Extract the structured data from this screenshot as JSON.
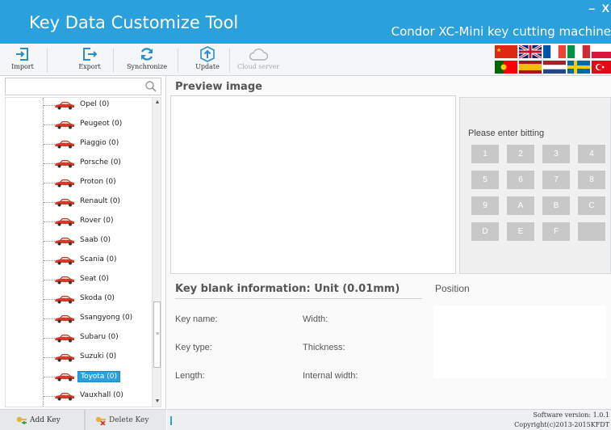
{
  "window": {
    "title": "Key Data Customize Tool",
    "subtitle": "Condor XC-Mini key cutting machine",
    "minimize_glyph": "–",
    "close_glyph": "X"
  },
  "toolbar": {
    "import_label": "Import",
    "export_label": "Export",
    "sync_label": "Synchronize",
    "update_label": "Update",
    "cloud_label": "Cloud server"
  },
  "languages": [
    "Chinese",
    "British",
    "French",
    "Italian",
    "Polish",
    "Portuguese",
    "Spanish",
    "Dutch",
    "Swedish",
    "Turkish"
  ],
  "tree": {
    "items": [
      {
        "label": "Opel (0)"
      },
      {
        "label": "Peugeot (0)"
      },
      {
        "label": "Piaggio (0)"
      },
      {
        "label": "Porsche (0)"
      },
      {
        "label": "Proton (0)"
      },
      {
        "label": "Renault (0)"
      },
      {
        "label": "Rover (0)"
      },
      {
        "label": "Saab (0)"
      },
      {
        "label": "Scania (0)"
      },
      {
        "label": "Seat (0)"
      },
      {
        "label": "Skoda (0)"
      },
      {
        "label": "Ssangyong (0)"
      },
      {
        "label": "Subaru (0)"
      },
      {
        "label": "Suzuki (0)"
      },
      {
        "label": "Toyota (0)"
      },
      {
        "label": "Vauxhall (0)"
      }
    ],
    "selected": "Toyota (0)"
  },
  "left_buttons": {
    "add": "Add Key",
    "delete": "Delete Key"
  },
  "preview": {
    "title": "Preview image"
  },
  "bitting": {
    "label": "Please enter bitting",
    "keys": [
      "1",
      "2",
      "3",
      "4",
      "5",
      "6",
      "7",
      "8",
      "9",
      "A",
      "B",
      "C",
      "D",
      "E",
      "F",
      ""
    ]
  },
  "key_info": {
    "title": "Key blank information: Unit (0.01mm)",
    "key_name": "Key name:",
    "key_type": "Key type:",
    "length": "Length:",
    "width": "Width:",
    "thickness": "Thickness:",
    "internal_width": "Internal width:"
  },
  "position": {
    "title": "Position"
  },
  "status": {
    "version": "Software version: 1.0.1",
    "copyright": "Copyright(c)2013-2015KFDT"
  },
  "colors": {
    "accent": "#2aa0dc",
    "car": "#d63a2a",
    "key_button": "#c8c8c8"
  }
}
